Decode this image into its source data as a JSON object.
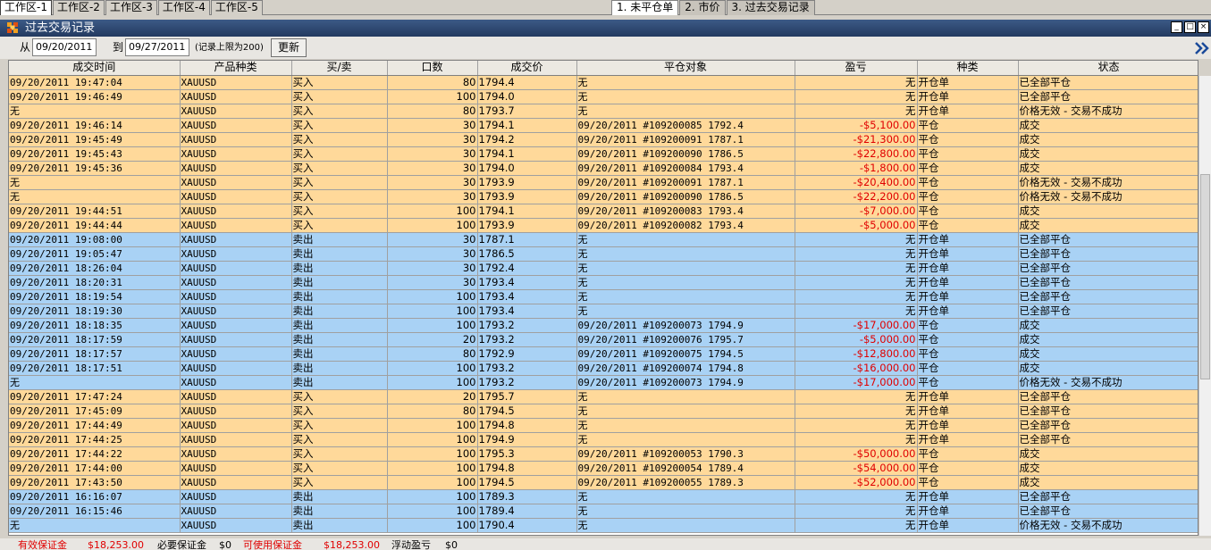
{
  "workspace_tabs": [
    "工作区-1",
    "工作区-2",
    "工作区-3",
    "工作区-4",
    "工作区-5"
  ],
  "view_tabs": [
    "1. 未平仓单",
    "2. 市价",
    "3. 过去交易记录"
  ],
  "window": {
    "title": "过去交易记录"
  },
  "filter": {
    "from_label": "从",
    "from_value": "09/20/2011",
    "to_label": "到",
    "to_value": "09/27/2011",
    "note": "(记录上限为200)",
    "refresh_label": "更新"
  },
  "columns": [
    "成交时间",
    "产品种类",
    "买/卖",
    "口数",
    "成交价",
    "平仓对象",
    "盈亏",
    "种类",
    "状态"
  ],
  "rows": [
    {
      "side": "buy",
      "time": "09/20/2011 19:47:04",
      "product": "XAUUSD",
      "bs": "买入",
      "qty": "80",
      "price": "1794.4",
      "target": "无",
      "pl": "无",
      "type": "开仓单",
      "status": "已全部平仓"
    },
    {
      "side": "buy",
      "time": "09/20/2011 19:46:49",
      "product": "XAUUSD",
      "bs": "买入",
      "qty": "100",
      "price": "1794.0",
      "target": "无",
      "pl": "无",
      "type": "开仓单",
      "status": "已全部平仓"
    },
    {
      "side": "buy",
      "time": "无",
      "product": "XAUUSD",
      "bs": "买入",
      "qty": "80",
      "price": "1793.7",
      "target": "无",
      "pl": "无",
      "type": "开仓单",
      "status": "价格无效 - 交易不成功"
    },
    {
      "side": "buy",
      "time": "09/20/2011 19:46:14",
      "product": "XAUUSD",
      "bs": "买入",
      "qty": "30",
      "price": "1794.1",
      "target": "09/20/2011 #109200085 1792.4",
      "pl": "-$5,100.00",
      "type": "平仓",
      "status": "成交"
    },
    {
      "side": "buy",
      "time": "09/20/2011 19:45:49",
      "product": "XAUUSD",
      "bs": "买入",
      "qty": "30",
      "price": "1794.2",
      "target": "09/20/2011 #109200091 1787.1",
      "pl": "-$21,300.00",
      "type": "平仓",
      "status": "成交"
    },
    {
      "side": "buy",
      "time": "09/20/2011 19:45:43",
      "product": "XAUUSD",
      "bs": "买入",
      "qty": "30",
      "price": "1794.1",
      "target": "09/20/2011 #109200090 1786.5",
      "pl": "-$22,800.00",
      "type": "平仓",
      "status": "成交"
    },
    {
      "side": "buy",
      "time": "09/20/2011 19:45:36",
      "product": "XAUUSD",
      "bs": "买入",
      "qty": "30",
      "price": "1794.0",
      "target": "09/20/2011 #109200084 1793.4",
      "pl": "-$1,800.00",
      "type": "平仓",
      "status": "成交"
    },
    {
      "side": "buy",
      "time": "无",
      "product": "XAUUSD",
      "bs": "买入",
      "qty": "30",
      "price": "1793.9",
      "target": "09/20/2011 #109200091 1787.1",
      "pl": "-$20,400.00",
      "type": "平仓",
      "status": "价格无效 - 交易不成功"
    },
    {
      "side": "buy",
      "time": "无",
      "product": "XAUUSD",
      "bs": "买入",
      "qty": "30",
      "price": "1793.9",
      "target": "09/20/2011 #109200090 1786.5",
      "pl": "-$22,200.00",
      "type": "平仓",
      "status": "价格无效 - 交易不成功"
    },
    {
      "side": "buy",
      "time": "09/20/2011 19:44:51",
      "product": "XAUUSD",
      "bs": "买入",
      "qty": "100",
      "price": "1794.1",
      "target": "09/20/2011 #109200083 1793.4",
      "pl": "-$7,000.00",
      "type": "平仓",
      "status": "成交"
    },
    {
      "side": "buy",
      "time": "09/20/2011 19:44:44",
      "product": "XAUUSD",
      "bs": "买入",
      "qty": "100",
      "price": "1793.9",
      "target": "09/20/2011 #109200082 1793.4",
      "pl": "-$5,000.00",
      "type": "平仓",
      "status": "成交"
    },
    {
      "side": "sell",
      "time": "09/20/2011 19:08:00",
      "product": "XAUUSD",
      "bs": "卖出",
      "qty": "30",
      "price": "1787.1",
      "target": "无",
      "pl": "无",
      "type": "开仓单",
      "status": "已全部平仓"
    },
    {
      "side": "sell",
      "time": "09/20/2011 19:05:47",
      "product": "XAUUSD",
      "bs": "卖出",
      "qty": "30",
      "price": "1786.5",
      "target": "无",
      "pl": "无",
      "type": "开仓单",
      "status": "已全部平仓"
    },
    {
      "side": "sell",
      "time": "09/20/2011 18:26:04",
      "product": "XAUUSD",
      "bs": "卖出",
      "qty": "30",
      "price": "1792.4",
      "target": "无",
      "pl": "无",
      "type": "开仓单",
      "status": "已全部平仓"
    },
    {
      "side": "sell",
      "time": "09/20/2011 18:20:31",
      "product": "XAUUSD",
      "bs": "卖出",
      "qty": "30",
      "price": "1793.4",
      "target": "无",
      "pl": "无",
      "type": "开仓单",
      "status": "已全部平仓"
    },
    {
      "side": "sell",
      "time": "09/20/2011 18:19:54",
      "product": "XAUUSD",
      "bs": "卖出",
      "qty": "100",
      "price": "1793.4",
      "target": "无",
      "pl": "无",
      "type": "开仓单",
      "status": "已全部平仓"
    },
    {
      "side": "sell",
      "time": "09/20/2011 18:19:30",
      "product": "XAUUSD",
      "bs": "卖出",
      "qty": "100",
      "price": "1793.4",
      "target": "无",
      "pl": "无",
      "type": "开仓单",
      "status": "已全部平仓"
    },
    {
      "side": "sell",
      "time": "09/20/2011 18:18:35",
      "product": "XAUUSD",
      "bs": "卖出",
      "qty": "100",
      "price": "1793.2",
      "target": "09/20/2011 #109200073 1794.9",
      "pl": "-$17,000.00",
      "type": "平仓",
      "status": "成交"
    },
    {
      "side": "sell",
      "time": "09/20/2011 18:17:59",
      "product": "XAUUSD",
      "bs": "卖出",
      "qty": "20",
      "price": "1793.2",
      "target": "09/20/2011 #109200076 1795.7",
      "pl": "-$5,000.00",
      "type": "平仓",
      "status": "成交"
    },
    {
      "side": "sell",
      "time": "09/20/2011 18:17:57",
      "product": "XAUUSD",
      "bs": "卖出",
      "qty": "80",
      "price": "1792.9",
      "target": "09/20/2011 #109200075 1794.5",
      "pl": "-$12,800.00",
      "type": "平仓",
      "status": "成交"
    },
    {
      "side": "sell",
      "time": "09/20/2011 18:17:51",
      "product": "XAUUSD",
      "bs": "卖出",
      "qty": "100",
      "price": "1793.2",
      "target": "09/20/2011 #109200074 1794.8",
      "pl": "-$16,000.00",
      "type": "平仓",
      "status": "成交"
    },
    {
      "side": "sell",
      "time": "无",
      "product": "XAUUSD",
      "bs": "卖出",
      "qty": "100",
      "price": "1793.2",
      "target": "09/20/2011 #109200073 1794.9",
      "pl": "-$17,000.00",
      "type": "平仓",
      "status": "价格无效 - 交易不成功"
    },
    {
      "side": "buy",
      "time": "09/20/2011 17:47:24",
      "product": "XAUUSD",
      "bs": "买入",
      "qty": "20",
      "price": "1795.7",
      "target": "无",
      "pl": "无",
      "type": "开仓单",
      "status": "已全部平仓"
    },
    {
      "side": "buy",
      "time": "09/20/2011 17:45:09",
      "product": "XAUUSD",
      "bs": "买入",
      "qty": "80",
      "price": "1794.5",
      "target": "无",
      "pl": "无",
      "type": "开仓单",
      "status": "已全部平仓"
    },
    {
      "side": "buy",
      "time": "09/20/2011 17:44:49",
      "product": "XAUUSD",
      "bs": "买入",
      "qty": "100",
      "price": "1794.8",
      "target": "无",
      "pl": "无",
      "type": "开仓单",
      "status": "已全部平仓"
    },
    {
      "side": "buy",
      "time": "09/20/2011 17:44:25",
      "product": "XAUUSD",
      "bs": "买入",
      "qty": "100",
      "price": "1794.9",
      "target": "无",
      "pl": "无",
      "type": "开仓单",
      "status": "已全部平仓"
    },
    {
      "side": "buy",
      "time": "09/20/2011 17:44:22",
      "product": "XAUUSD",
      "bs": "买入",
      "qty": "100",
      "price": "1795.3",
      "target": "09/20/2011 #109200053 1790.3",
      "pl": "-$50,000.00",
      "type": "平仓",
      "status": "成交"
    },
    {
      "side": "buy",
      "time": "09/20/2011 17:44:00",
      "product": "XAUUSD",
      "bs": "买入",
      "qty": "100",
      "price": "1794.8",
      "target": "09/20/2011 #109200054 1789.4",
      "pl": "-$54,000.00",
      "type": "平仓",
      "status": "成交"
    },
    {
      "side": "buy",
      "time": "09/20/2011 17:43:50",
      "product": "XAUUSD",
      "bs": "买入",
      "qty": "100",
      "price": "1794.5",
      "target": "09/20/2011 #109200055 1789.3",
      "pl": "-$52,000.00",
      "type": "平仓",
      "status": "成交"
    },
    {
      "side": "sell",
      "time": "09/20/2011 16:16:07",
      "product": "XAUUSD",
      "bs": "卖出",
      "qty": "100",
      "price": "1789.3",
      "target": "无",
      "pl": "无",
      "type": "开仓单",
      "status": "已全部平仓"
    },
    {
      "side": "sell",
      "time": "09/20/2011 16:15:46",
      "product": "XAUUSD",
      "bs": "卖出",
      "qty": "100",
      "price": "1789.4",
      "target": "无",
      "pl": "无",
      "type": "开仓单",
      "status": "已全部平仓"
    },
    {
      "side": "sell",
      "time": "无",
      "product": "XAUUSD",
      "bs": "卖出",
      "qty": "100",
      "price": "1790.4",
      "target": "无",
      "pl": "无",
      "type": "开仓单",
      "status": "价格无效 - 交易不成功"
    }
  ],
  "status_bar": {
    "effective_margin_label": "有效保证金",
    "effective_margin_value": "$18,253.00",
    "required_margin_label": "必要保证金",
    "required_margin_value": "$0",
    "available_margin_label": "可使用保证金",
    "available_margin_value": "$18,253.00",
    "floating_pl_label": "浮动盈亏",
    "floating_pl_value": "$0"
  },
  "colors": {
    "buy_row": "#ffd99a",
    "sell_row": "#a9d2f5",
    "loss_text": "#e00000",
    "title_bar": "#2b4470"
  }
}
